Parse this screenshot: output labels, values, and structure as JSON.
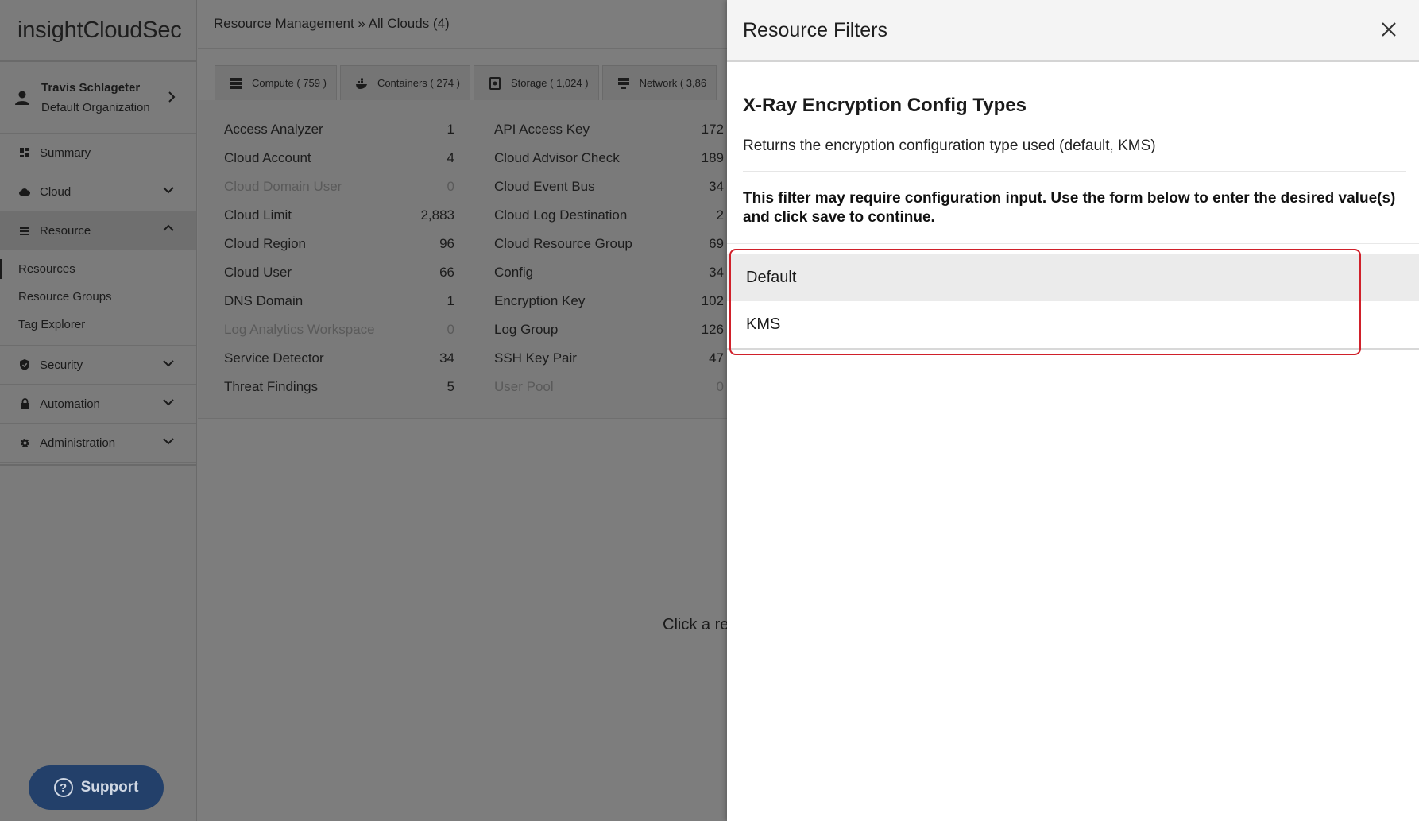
{
  "app": {
    "logo_prefix": "insight",
    "logo_suffix": "CloudSec"
  },
  "user": {
    "name": "Travis Schlageter",
    "org": "Default Organization"
  },
  "nav": {
    "summary": "Summary",
    "cloud": "Cloud",
    "resource": "Resource",
    "resource_sub": [
      "Resources",
      "Resource Groups",
      "Tag Explorer"
    ],
    "security": "Security",
    "automation": "Automation",
    "administration": "Administration"
  },
  "support_label": "Support",
  "breadcrumb": "Resource Management » All Clouds (4)",
  "tabs": [
    {
      "label": "Compute ( 759 )"
    },
    {
      "label": "Containers ( 274 )"
    },
    {
      "label": "Storage ( 1,024 )"
    },
    {
      "label": "Network ( 3,86"
    }
  ],
  "resources_left": [
    {
      "name": "Access Analyzer",
      "count": "1"
    },
    {
      "name": "Cloud Account",
      "count": "4"
    },
    {
      "name": "Cloud Domain User",
      "count": "0"
    },
    {
      "name": "Cloud Limit",
      "count": "2,883"
    },
    {
      "name": "Cloud Region",
      "count": "96"
    },
    {
      "name": "Cloud User",
      "count": "66"
    },
    {
      "name": "DNS Domain",
      "count": "1"
    },
    {
      "name": "Log Analytics Workspace",
      "count": "0"
    },
    {
      "name": "Service Detector",
      "count": "34"
    },
    {
      "name": "Threat Findings",
      "count": "5"
    }
  ],
  "resources_right": [
    {
      "name": "API Access Key",
      "count": "172"
    },
    {
      "name": "Cloud Advisor Check",
      "count": "189"
    },
    {
      "name": "Cloud Event Bus",
      "count": "34"
    },
    {
      "name": "Cloud Log Destination",
      "count": "2"
    },
    {
      "name": "Cloud Resource Group",
      "count": "69"
    },
    {
      "name": "Config",
      "count": "34"
    },
    {
      "name": "Encryption Key",
      "count": "102"
    },
    {
      "name": "Log Group",
      "count": "126"
    },
    {
      "name": "SSH Key Pair",
      "count": "47"
    },
    {
      "name": "User Pool",
      "count": "0"
    }
  ],
  "click_hint": "Click a re",
  "panel": {
    "title": "Resource Filters",
    "filter_title": "X-Ray Encryption Config Types",
    "filter_desc": "Returns the encryption configuration type used (default, KMS)",
    "filter_note": "This filter may require configuration input. Use the form below to enter the desired value(s) and click save to continue.",
    "options": [
      "Default",
      "KMS"
    ]
  },
  "colors": {
    "accent_red": "#d0202a",
    "support_blue": "#23406a"
  }
}
